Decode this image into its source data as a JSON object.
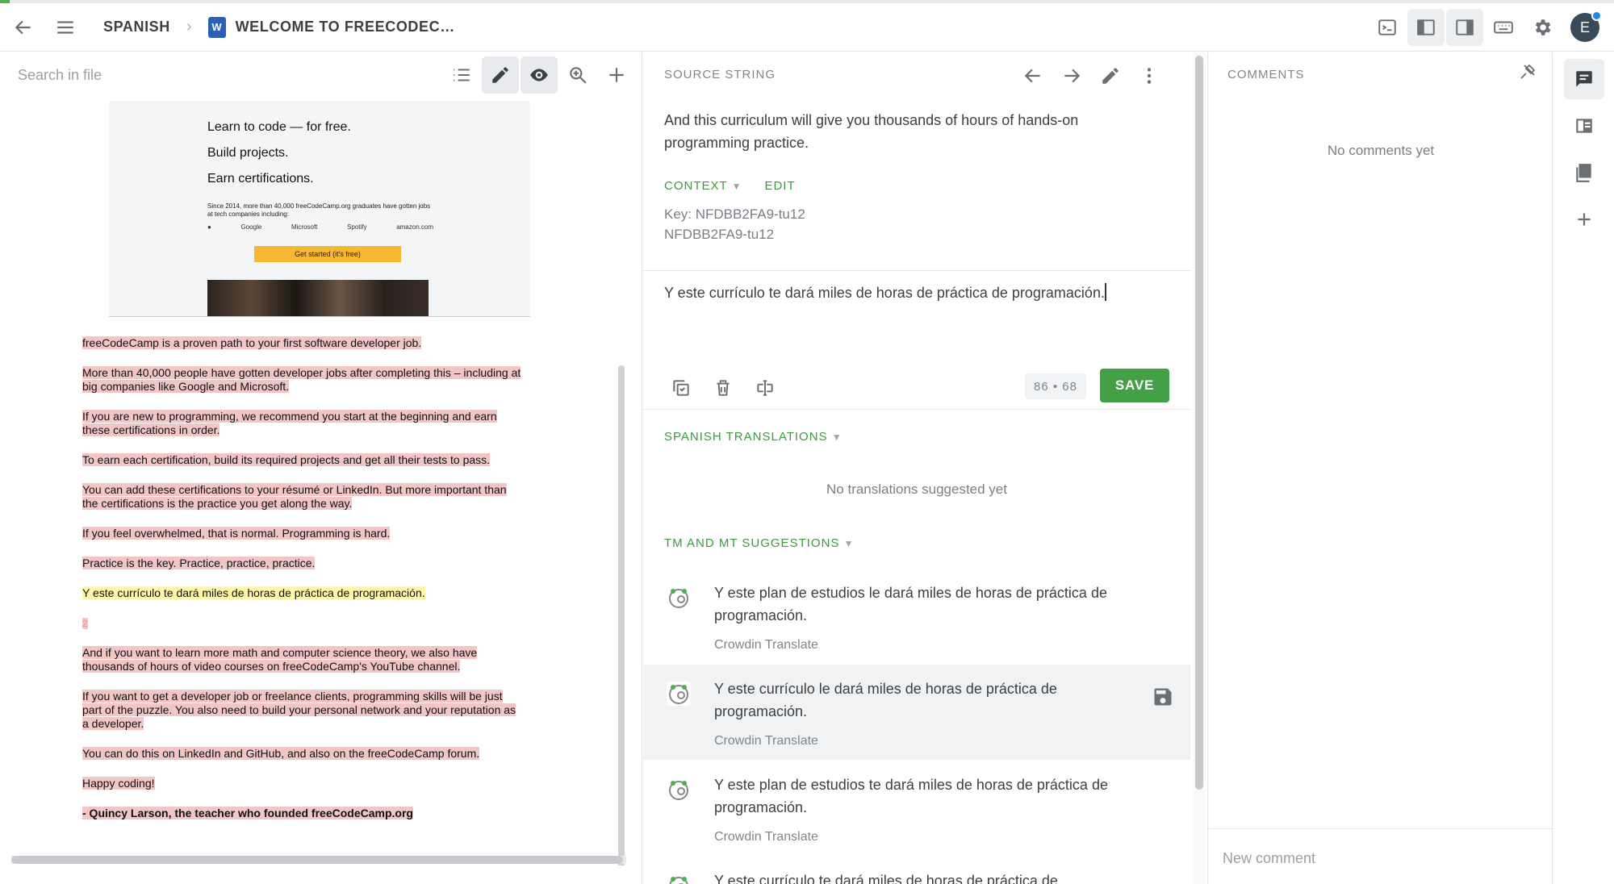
{
  "topbar": {
    "breadcrumb_project": "SPANISH",
    "breadcrumb_file": "WELCOME TO FREECODEC…",
    "avatar_initial": "E"
  },
  "left": {
    "search_placeholder": "Search in file",
    "preview": {
      "heading1": "Learn to code — for free.",
      "heading2": "Build projects.",
      "heading3": "Earn certifications.",
      "small_text": "Since 2014, more than 40,000 freeCodeCamp.org graduates have gotten jobs at tech companies including:",
      "logos": [
        "",
        "Google",
        "Microsoft",
        "Spotify",
        "amazon.com"
      ],
      "cta": "Get started (it's free)"
    },
    "paragraphs": [
      {
        "lines": [
          "freeCodeCamp is a proven path to your first software developer job."
        ],
        "style": "hl"
      },
      {
        "lines": [
          "More than 40,000 people have gotten developer jobs after completing this – including at",
          "big companies like Google and Microsoft."
        ],
        "style": "hl"
      },
      {
        "lines": [
          "If you are new to programming, we recommend you start at the beginning and earn",
          "these certifications in order."
        ],
        "style": "hl"
      },
      {
        "lines": [
          "To earn each certification, build its required projects and get all their tests to pass."
        ],
        "style": "hl"
      },
      {
        "lines": [
          "You can add these certifications to your résumé or LinkedIn. But more important than",
          "the certifications is the practice you get along the way."
        ],
        "style": "hl"
      },
      {
        "lines": [
          "If you feel overwhelmed, that is normal. Programming is hard."
        ],
        "style": "hl"
      },
      {
        "lines": [
          "Practice is the key. Practice, practice, practice."
        ],
        "style": "hl"
      },
      {
        "lines": [
          "Y este currículo te dará miles de horas de práctica de programación."
        ],
        "style": "hl-y"
      },
      {
        "lines": [
          "2"
        ],
        "style": "hl"
      },
      {
        "lines": [
          "And if you want to learn more math and computer science theory, we also have",
          "thousands of hours of video courses on freeCodeCamp's YouTube channel."
        ],
        "style": "hl"
      },
      {
        "lines": [
          "If you want to get a developer job or freelance clients, programming skills will be just",
          "part of the puzzle. You also need to build your personal network and your reputation as",
          "a developer."
        ],
        "style": "hl"
      },
      {
        "lines": [
          "You can do this on LinkedIn and GitHub, and also on the freeCodeCamp forum."
        ],
        "style": "hl"
      },
      {
        "lines": [
          "Happy coding!"
        ],
        "style": "hl"
      },
      {
        "lines": [
          "- Quincy Larson, the teacher who founded freeCodeCamp.org"
        ],
        "style": "hl-bold"
      }
    ]
  },
  "mid": {
    "source_label": "SOURCE STRING",
    "source_text": "And this curriculum will give you thousands of hours of hands-on programming practice.",
    "context_label": "CONTEXT",
    "edit_label": "EDIT",
    "key_line1": "Key: NFDBB2FA9-tu12",
    "key_line2": "NFDBB2FA9-tu12",
    "translation_text": "Y este currículo te dará miles de horas de práctica de programación.",
    "counter": "86 • 68",
    "save_label": "SAVE",
    "translations_label": "SPANISH TRANSLATIONS",
    "no_translations": "No translations suggested yet",
    "tm_label": "TM AND MT SUGGESTIONS",
    "suggestions": [
      {
        "text": "Y este plan de estudios le dará miles de horas de práctica de programación.",
        "source": "Crowdin Translate"
      },
      {
        "text": "Y este currículo le dará miles de horas de práctica de programación.",
        "source": "Crowdin Translate"
      },
      {
        "text": "Y este plan de estudios te dará miles de horas de práctica de programación.",
        "source": "Crowdin Translate"
      },
      {
        "text": "Y este currículo te dará miles de horas de práctica de",
        "source": ""
      }
    ]
  },
  "comments": {
    "label": "COMMENTS",
    "empty": "No comments yet",
    "new_placeholder": "New comment"
  }
}
